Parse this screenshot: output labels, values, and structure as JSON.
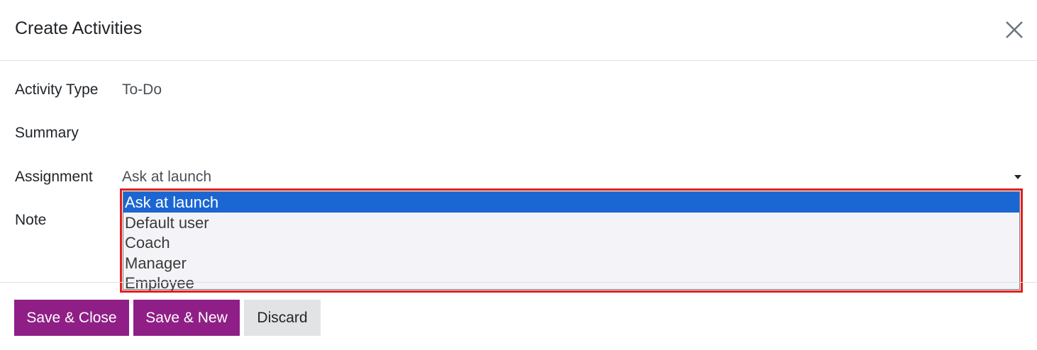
{
  "dialog": {
    "title": "Create Activities",
    "close_icon": "close-icon"
  },
  "form": {
    "activity_type": {
      "label": "Activity Type",
      "value": "To-Do"
    },
    "summary": {
      "label": "Summary"
    },
    "assignment": {
      "label": "Assignment",
      "value": "Ask at launch",
      "options": [
        "Ask at launch",
        "Default user",
        "Coach",
        "Manager",
        "Employee"
      ],
      "selected_index": 0
    },
    "note": {
      "label": "Note"
    }
  },
  "footer": {
    "save_close_label": "Save & Close",
    "save_new_label": "Save & New",
    "discard_label": "Discard"
  },
  "colors": {
    "primary": "#8f1f86",
    "highlight": "#1a66d2",
    "annotation_border": "#e02020"
  }
}
